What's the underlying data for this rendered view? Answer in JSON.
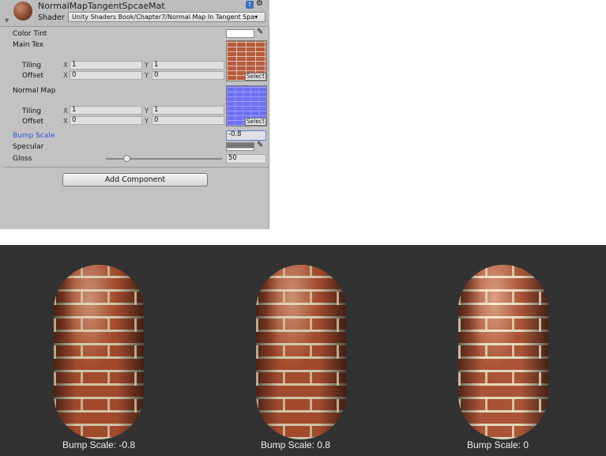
{
  "inspector": {
    "material_name": "NormalMapTangentSpcaeMat",
    "shader_label": "Shader",
    "shader_value": "Unity Shaders Book/Chapter7/Normal Map In Tangent Spa▾",
    "help_icon": "?",
    "props": {
      "color_tint": "Color Tint",
      "main_tex": "Main Tex",
      "tiling": "Tiling",
      "offset": "Offset",
      "x": "X",
      "y": "Y",
      "main_tiling_x": "1",
      "main_tiling_y": "1",
      "main_offset_x": "0",
      "main_offset_y": "0",
      "normal_map": "Normal Map",
      "nm_tiling_x": "1",
      "nm_tiling_y": "1",
      "nm_offset_x": "0",
      "nm_offset_y": "0",
      "select": "Select",
      "bump_scale": "Bump Scale",
      "bump_value": "-0.8",
      "specular": "Specular",
      "gloss": "Gloss",
      "gloss_value": "50",
      "gloss_fraction": 0.14
    },
    "add_component": "Add Component",
    "accent": "#2a5ad8"
  },
  "scene": {
    "captions": [
      "Bump Scale:  -0.8",
      "Bump Scale:  0.8",
      "Bump Scale:  0"
    ]
  }
}
